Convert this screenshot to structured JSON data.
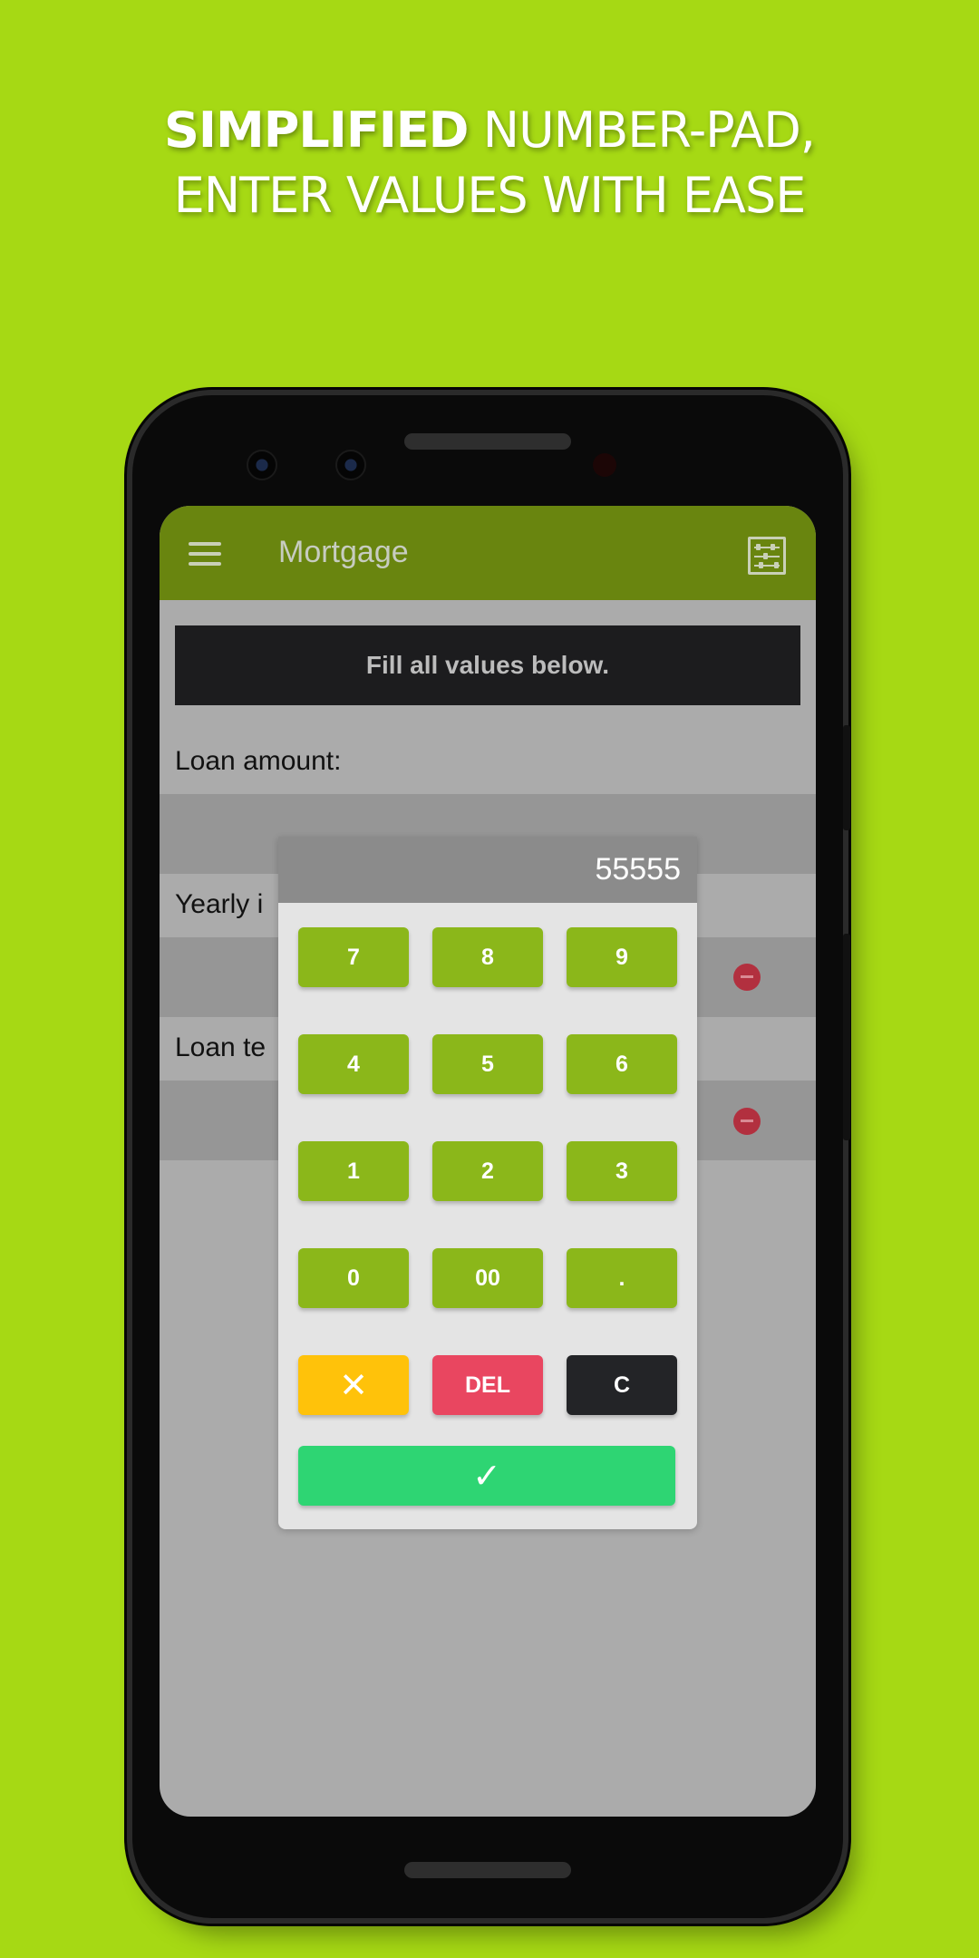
{
  "headline": {
    "line1_bold": "SIMPLIFIED",
    "line1_rest": " NUMBER-PAD,",
    "line2": "ENTER VALUES WITH  EASE"
  },
  "app": {
    "title": "Mortgage",
    "menu_icon": "hamburger-menu-icon",
    "action_icon": "abacus-icon",
    "notice": "Fill all values below.",
    "fields": [
      {
        "label": "Loan amount:"
      },
      {
        "label": "Yearly i"
      },
      {
        "label": "Loan te"
      }
    ]
  },
  "numpad": {
    "display": "55555",
    "keys": [
      "7",
      "8",
      "9",
      "4",
      "5",
      "6",
      "1",
      "2",
      "3",
      "0",
      "00",
      "."
    ],
    "cancel": "✕",
    "delete": "DEL",
    "clear": "C",
    "confirm": "✓"
  },
  "colors": {
    "background": "#a6d914",
    "appbar": "#69850f",
    "key_number": "#8bb71a",
    "key_cancel": "#ffc20a",
    "key_delete": "#e94660",
    "key_clear": "#232427",
    "key_confirm": "#2ed573"
  }
}
